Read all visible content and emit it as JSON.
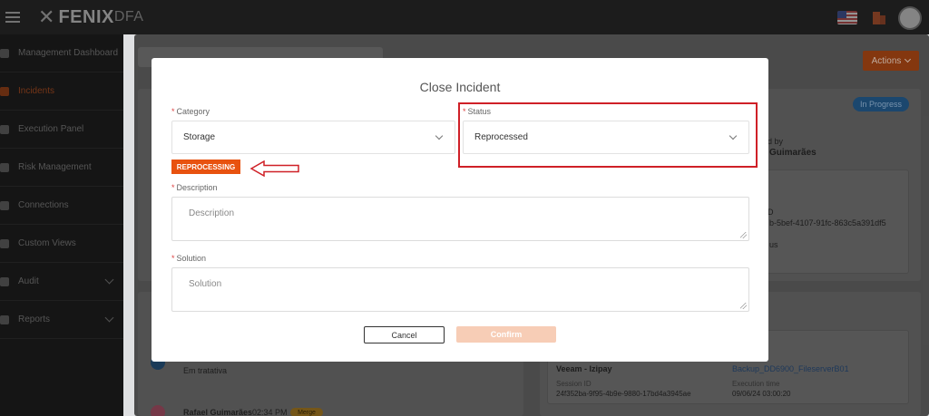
{
  "app": {
    "logo_main": "FENIX",
    "logo_sub": "DFA"
  },
  "sidebar": {
    "items": [
      {
        "label": "Management Dashboard",
        "active": false
      },
      {
        "label": "Incidents",
        "active": true
      },
      {
        "label": "Execution Panel",
        "active": false
      },
      {
        "label": "Risk Management",
        "active": false
      },
      {
        "label": "Connections",
        "active": false
      },
      {
        "label": "Custom Views",
        "active": false
      },
      {
        "label": "Audit",
        "active": false,
        "has_submenu": true
      },
      {
        "label": "Reports",
        "active": false,
        "has_submenu": true
      }
    ]
  },
  "header": {
    "actions_label": "Actions"
  },
  "incident": {
    "status": "In Progress",
    "assigned_label": "d by",
    "assigned_name": "Guimarães",
    "id_fragment_label": "D",
    "id_fragment": "b-5bef-4107-91fc-863c5a391df5",
    "status_fragment": "us"
  },
  "timeline": {
    "entry_status": "Em tratativa",
    "author": "Rafael Guimarães",
    "time": "02:34 PM",
    "badge": "Merge"
  },
  "execution": {
    "job": "Veeam - Izipay",
    "backup_link": "Backup_DD6900_FileserverB01",
    "session_label": "Session ID",
    "session_id": "24f352ba-9f95-4b9e-9880-17bd4a3945ae",
    "exec_time_label": "Execution time",
    "exec_time": "09/06/24 03:00:20"
  },
  "modal": {
    "title": "Close Incident",
    "category": {
      "label": "Category",
      "value": "Storage"
    },
    "status": {
      "label": "Status",
      "value": "Reprocessed"
    },
    "badge": "REPROCESSING",
    "description": {
      "label": "Description",
      "placeholder": "Description"
    },
    "solution": {
      "label": "Solution",
      "placeholder": "Solution"
    },
    "cancel_label": "Cancel",
    "confirm_label": "Confirm"
  },
  "colors": {
    "accent": "#e8520f",
    "confirm_disabled": "#f7cdb6",
    "annotation_red": "#cf2027",
    "status_blue": "#1d4a73"
  }
}
